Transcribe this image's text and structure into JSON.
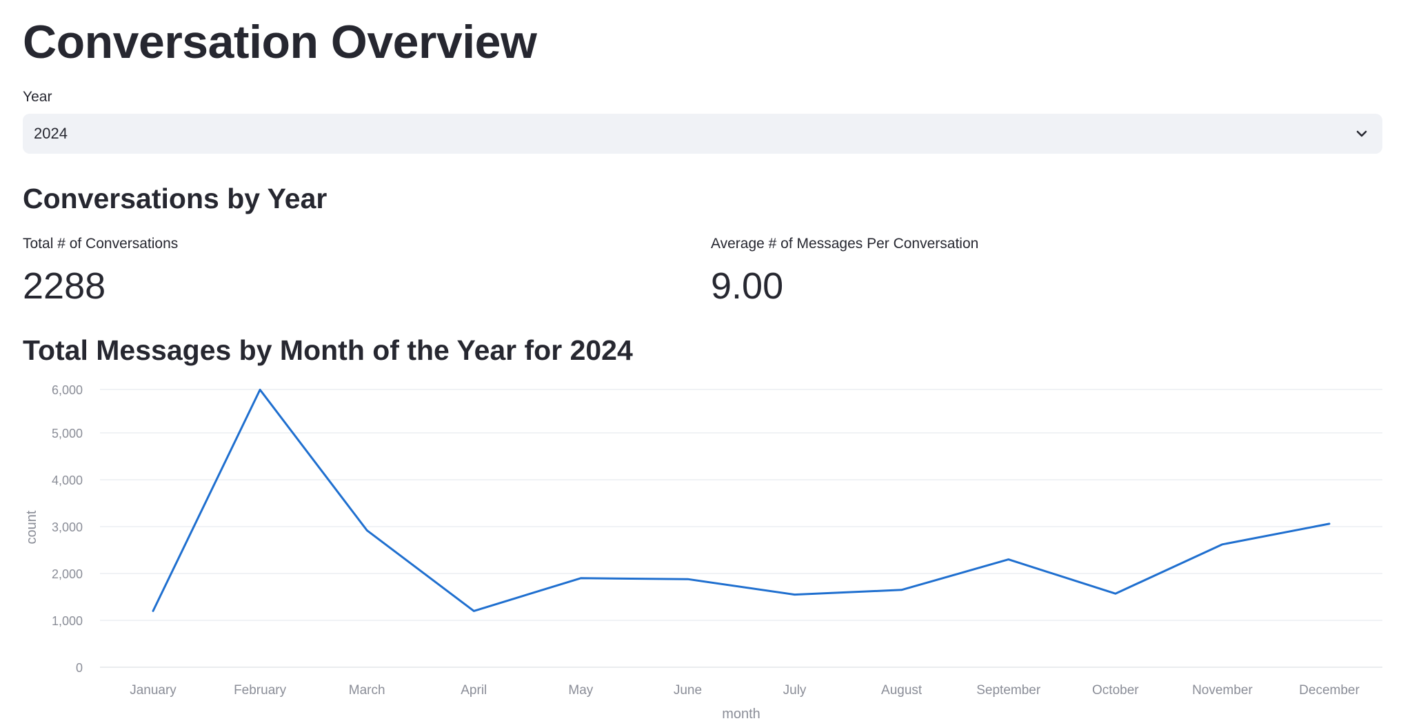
{
  "page": {
    "title": "Conversation Overview"
  },
  "year_select": {
    "label": "Year",
    "value": "2024",
    "icon": "chevron-down-icon"
  },
  "section_conversations": {
    "title": "Conversations by Year"
  },
  "metrics": [
    {
      "label": "Total # of Conversations",
      "value": "2288"
    },
    {
      "label": "Average # of Messages Per Conversation",
      "value": "9.00"
    }
  ],
  "section_messages": {
    "title": "Total Messages by Month of the Year for 2024"
  },
  "chart_data": {
    "type": "line",
    "x": [
      "January",
      "February",
      "March",
      "April",
      "May",
      "June",
      "July",
      "August",
      "September",
      "October",
      "November",
      "December"
    ],
    "series": [
      {
        "values": [
          1200,
          5920,
          2920,
          1200,
          1900,
          1880,
          1550,
          1650,
          2300,
          1570,
          2620,
          3060
        ]
      }
    ],
    "xlabel": "month",
    "ylabel": "count",
    "ylim": [
      0,
      6000
    ],
    "yticks": [
      0,
      1000,
      2000,
      3000,
      4000,
      5000,
      6000
    ],
    "ytick_labels": [
      "0",
      "1,000",
      "2,000",
      "3,000",
      "4,000",
      "5,000",
      "6,000"
    ],
    "grid": true,
    "line_color": "#1f6fcf"
  }
}
